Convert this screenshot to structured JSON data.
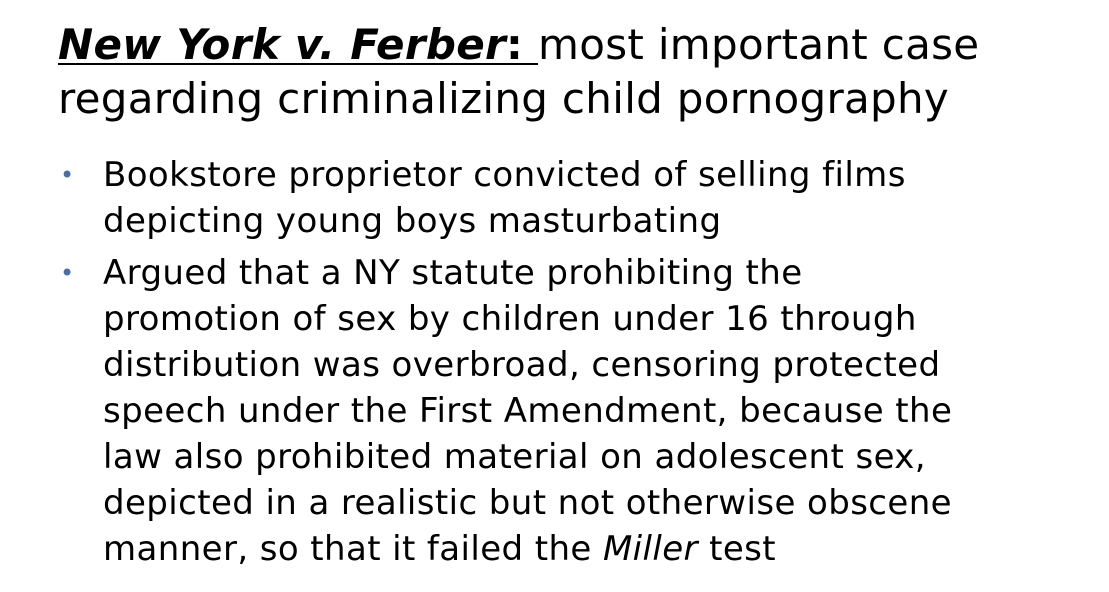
{
  "title": {
    "case_name": "New York v. Ferber",
    "colon": ": ",
    "rest_line1": "most important case",
    "rest_line2": "regarding criminalizing child pornography"
  },
  "bullets": [
    {
      "lines": [
        "Bookstore proprietor convicted of selling films",
        "depicting young boys masturbating"
      ]
    },
    {
      "lines": [
        "Argued that a NY statute prohibiting the",
        "promotion of sex by children under 16 through",
        "distribution was overbroad, censoring protected",
        "speech under the First Amendment, because the",
        "law also prohibited material on adolescent sex,",
        "depicted in a realistic but not otherwise obscene"
      ],
      "last_line_before": "manner, so that it failed the ",
      "last_line_italic": "Miller",
      "last_line_after": " test"
    }
  ],
  "bullet_symbol": "•",
  "colors": {
    "text": "#000000",
    "bullet": "#4a6ea9",
    "background": "#ffffff"
  }
}
